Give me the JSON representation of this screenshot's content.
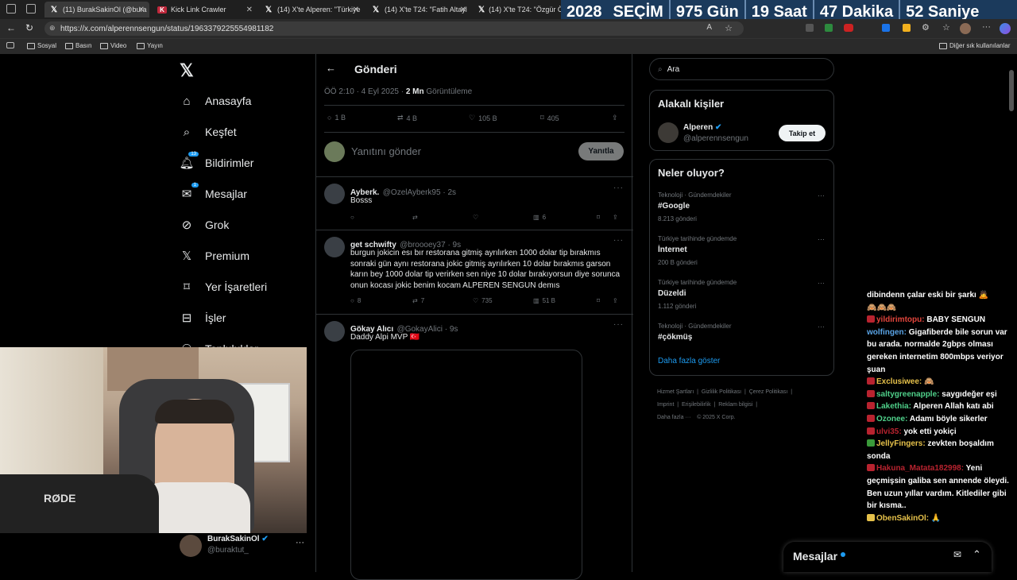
{
  "browser": {
    "tabs": [
      {
        "label": "(11) BurakSakinOl (@bura",
        "icon": "x-logo-icon"
      },
      {
        "label": "Kick Link Crawler",
        "icon": "kick-icon"
      },
      {
        "label": "(14) X'te Alperen: \"Türkiye",
        "icon": "x-logo-icon"
      },
      {
        "label": "(14) X'te T24: \"Fatih Altayl",
        "icon": "x-logo-icon"
      },
      {
        "label": "(14) X'te T24: \"Özgür Öze",
        "icon": "x-logo-icon"
      }
    ],
    "url": "https://x.com/alperennsengun/status/1963379225554981182",
    "bookmarks": [
      "Sosyal",
      "Basın",
      "Video",
      "Yayın"
    ],
    "other_bookmarks": "Diğer sık kullanılanlar"
  },
  "countdown": {
    "year": "2028",
    "label": "SEÇİM",
    "days": "975 Gün",
    "hours": "19 Saat",
    "minutes": "47 Dakika",
    "seconds": "52 Saniye"
  },
  "nav": {
    "items": [
      {
        "label": "Anasayfa",
        "icon": "home-icon"
      },
      {
        "label": "Keşfet",
        "icon": "search-icon"
      },
      {
        "label": "Bildirimler",
        "icon": "bell-icon",
        "badge": "13"
      },
      {
        "label": "Mesajlar",
        "icon": "mail-icon",
        "badge": "1"
      },
      {
        "label": "Grok",
        "icon": "grok-icon"
      },
      {
        "label": "Premium",
        "icon": "x-logo-icon"
      },
      {
        "label": "Yer İşaretleri",
        "icon": "bookmark-icon"
      },
      {
        "label": "İşler",
        "icon": "briefcase-icon"
      },
      {
        "label": "Topluluklar",
        "icon": "people-icon"
      }
    ],
    "account": {
      "name": "BurakSakinOl",
      "handle": "@buraktut_"
    }
  },
  "post": {
    "header": "Gönderi",
    "meta_time": "ÖÖ 2:10 · 4 Eyl 2025 · ",
    "views_count": "2 Mn",
    "views_label": " Görüntüleme",
    "replies": "1 B",
    "reposts": "4 B",
    "likes": "105 B",
    "bookmarks": "405",
    "reply_placeholder": "Yanıtını gönder",
    "reply_button": "Yanıtla"
  },
  "replies": [
    {
      "name": "Ayberk.",
      "handle": "@OzelAyberk95 · 2s",
      "text": "Bosss",
      "replies": "",
      "reposts": "",
      "likes": "",
      "views": "6"
    },
    {
      "name": "get schwifty",
      "handle": "@broooey37 · 9s",
      "text": "burgun jokicin esı bır restorana gitmiş ayrılırken 1000 dolar tip bırakmıs sonraki gün aynı restorana jokic gitmiş ayrılırken 10 dolar bırakmıs garson karın bey 1000 dolar tip verirken sen niye 10 dolar bırakıyorsun diye sorunca onun kocası jokic benim kocam ALPEREN SENGUN demıs",
      "replies": "8",
      "reposts": "7",
      "likes": "735",
      "views": "51 B"
    },
    {
      "name": "Gökay Alıcı",
      "handle": "@GokayAlici · 9s",
      "text": "Daddy Alpi MVP 🇹🇷"
    }
  ],
  "right": {
    "search_placeholder": "Ara",
    "related_title": "Alakalı kişiler",
    "related_user": {
      "name": "Alperen",
      "handle": "@alperennsengun",
      "button": "Takip et"
    },
    "trends_title": "Neler oluyor?",
    "trends": [
      {
        "meta": "Teknoloji · Gündemdekiler",
        "title": "#Google",
        "count": "8.213 gönderi"
      },
      {
        "meta": "Türkiye tarihinde gündemde",
        "title": "İnternet",
        "count": "200 B gönderi"
      },
      {
        "meta": "Türkiye tarihinde gündemde",
        "title": "Düzeldi",
        "count": "1.112 gönderi"
      },
      {
        "meta": "Teknoloji · Gündemdekiler",
        "title": "#çökmüş",
        "count": ""
      }
    ],
    "show_more": "Daha fazla göster",
    "footer_row1": [
      "Hizmet Şartları",
      "Gizlilik Politikası",
      "Çerez Politikası"
    ],
    "footer_row2": [
      "Imprint",
      "Erişilebilirlik",
      "Reklam bilgisi"
    ],
    "footer_row3": "Daha fazla ···",
    "copyright": "© 2025 X Corp."
  },
  "messages_drawer": "Mesajlar",
  "chat": [
    {
      "user": "",
      "text": "dibindenn çalar eski bir şarkı 🙇",
      "color": "#ffffff"
    },
    {
      "user": "",
      "text": "🙈🙈🙈",
      "color": "#ffffff"
    },
    {
      "user": "yildirimtopu:",
      "text": "BABY SENGUN",
      "color": "#b8232f"
    },
    {
      "user": "wolfingen:",
      "text": "Gigafiberde bile sorun var bu arada. normalde 2gbps olması gereken internetim 800mbps veriyor şuan",
      "color": "#5aa4e6"
    },
    {
      "user": "Exclusiwee:",
      "text": "🙈",
      "color": "#e6c14a"
    },
    {
      "user": "saltygreenapple:",
      "text": "saygıdeğer eşi",
      "color": "#4fd08a"
    },
    {
      "user": "Lakethia:",
      "text": "Alperen Allah katı abi",
      "color": "#4fd08a"
    },
    {
      "user": "Ozonee:",
      "text": "Adamı böyle sikerler",
      "color": "#4fd08a"
    },
    {
      "user": "ulvi35:",
      "text": "yok etti yokiçi",
      "color": "#b8232f"
    },
    {
      "user": "JellyFingers:",
      "text": "zevkten boşaldım sonda",
      "color": "#e6c14a"
    },
    {
      "user": "Hakuna_Matata182998:",
      "text": "Yeni geçmişsin galiba sen annende öleydi. Ben uzun yıllar vardım. Kitlediler gibi bir kısma..",
      "color": "#b8232f"
    },
    {
      "user": "ObenSakinOl:",
      "text": "🙏",
      "color": "#e6c14a"
    }
  ]
}
